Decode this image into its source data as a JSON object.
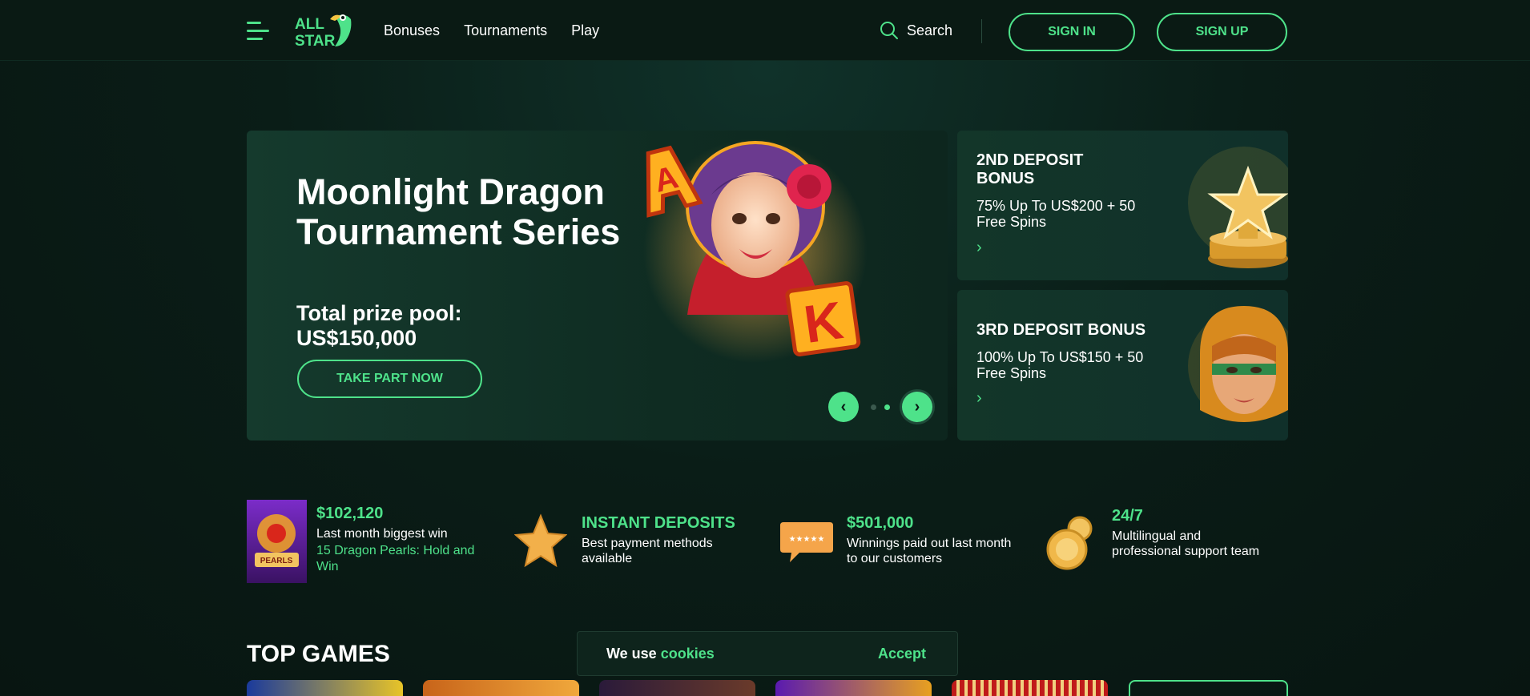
{
  "header": {
    "logo_text_1": "ALL",
    "logo_text_2": "STAR",
    "nav": [
      "Bonuses",
      "Tournaments",
      "Play"
    ],
    "search_label": "Search",
    "sign_in": "SIGN IN",
    "sign_up": "SIGN UP"
  },
  "hero": {
    "title": "Moonlight Dragon Tournament Series",
    "subtitle": "Total prize pool: US$150,000",
    "cta": "TAKE PART NOW",
    "art_letters": [
      "A",
      "K"
    ],
    "active_slide": 2,
    "slide_count": 2
  },
  "bonuses": [
    {
      "title": "2ND DEPOSIT BONUS",
      "desc": "75% Up To US$200 + 50 Free Spins"
    },
    {
      "title": "3RD DEPOSIT BONUS",
      "desc": "100% Up To US$150 + 50 Free Spins"
    }
  ],
  "stats": [
    {
      "value": "$102,120",
      "desc": "Last month biggest win",
      "sub": "15 Dragon Pearls: Hold and Win",
      "thumb_text": "PEARLS"
    },
    {
      "value": "INSTANT DEPOSITS",
      "desc": "Best payment methods available"
    },
    {
      "value": "$501,000",
      "desc": "Winnings paid out last month to our customers"
    },
    {
      "value": "24/7",
      "desc": "Multilingual and professional support team"
    }
  ],
  "top_games": {
    "title": "TOP GAMES"
  },
  "cookie": {
    "prefix": "We use",
    "link": "cookies",
    "accept": "Accept"
  },
  "colors": {
    "accent": "#4ee28a",
    "background": "#0a1a14",
    "card": "#133629"
  }
}
